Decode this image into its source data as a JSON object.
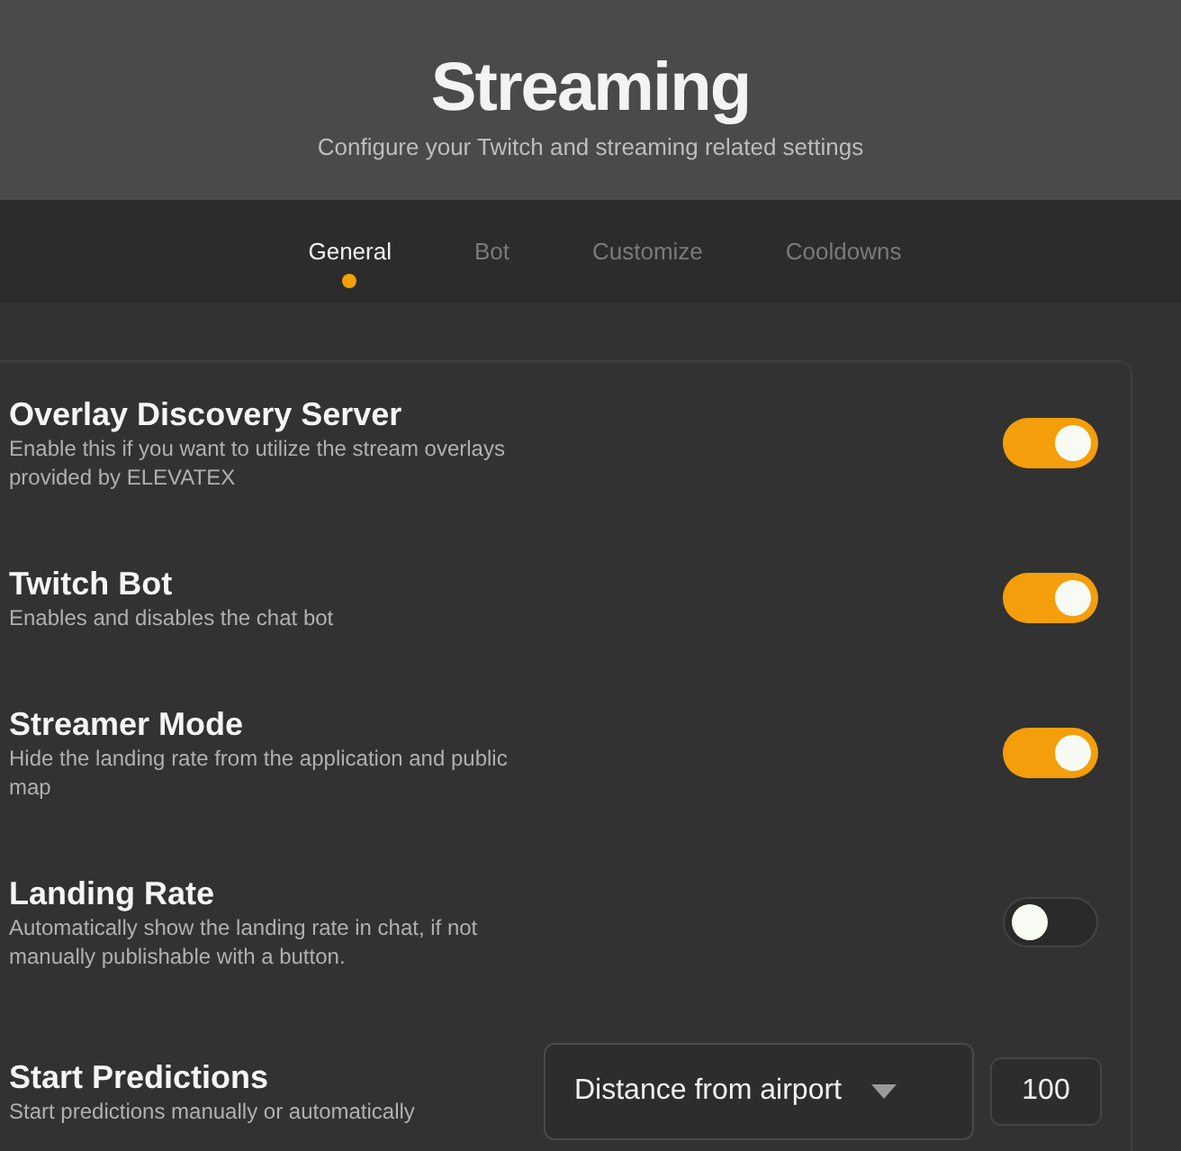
{
  "header": {
    "title": "Streaming",
    "subtitle": "Configure your Twitch and streaming related settings"
  },
  "tabs": [
    {
      "label": "General",
      "selected": true
    },
    {
      "label": "Bot",
      "selected": false
    },
    {
      "label": "Customize",
      "selected": false
    },
    {
      "label": "Cooldowns",
      "selected": false
    }
  ],
  "settings": [
    {
      "kind": "toggle",
      "title": "Overlay Discovery Server",
      "description": "Enable this if you want to utilize the stream overlays provided by ELEVATEX",
      "on": true
    },
    {
      "kind": "toggle",
      "title": "Twitch Bot",
      "description": "Enables and disables the chat bot",
      "on": true
    },
    {
      "kind": "toggle",
      "title": "Streamer Mode",
      "description": "Hide the landing rate from the application and public map",
      "on": true
    },
    {
      "kind": "toggle",
      "title": "Landing Rate",
      "description": "Automatically show the landing rate in chat, if not manually publishable with a button.",
      "on": false
    },
    {
      "kind": "select",
      "title": "Start Predictions",
      "description": "Start predictions manually or automatically",
      "select_value": "Distance from airport",
      "input_value": "100"
    }
  ]
}
